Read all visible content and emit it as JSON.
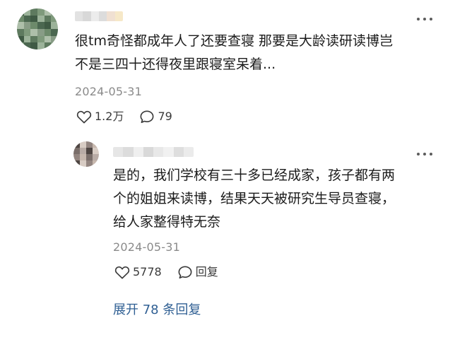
{
  "comment": {
    "lines": [
      "很tm奇怪都成年人了还要查寝 那要是大龄读研读博岂",
      "不是三四十还得夜里跟寝室呆着..."
    ],
    "date": "2024-05-31",
    "likes": "1.2万",
    "replies": "79"
  },
  "reply": {
    "lines": [
      "是的，我们学校有三十多已经成家，孩子都有两",
      "个的姐姐来读博，结果天天被研究生导员查寝，",
      "给人家整得特无奈"
    ],
    "date": "2024-05-31",
    "likes": "5778",
    "reply_label": "回复"
  },
  "expand_replies": "展开 78 条回复",
  "icons": {
    "like": "heart-outline-icon",
    "comment": "speech-bubble-icon",
    "more": "more-dots-icon"
  },
  "colors": {
    "link": "#2f5f93",
    "date": "#8a8a8a",
    "text": "#1b1b1b"
  }
}
